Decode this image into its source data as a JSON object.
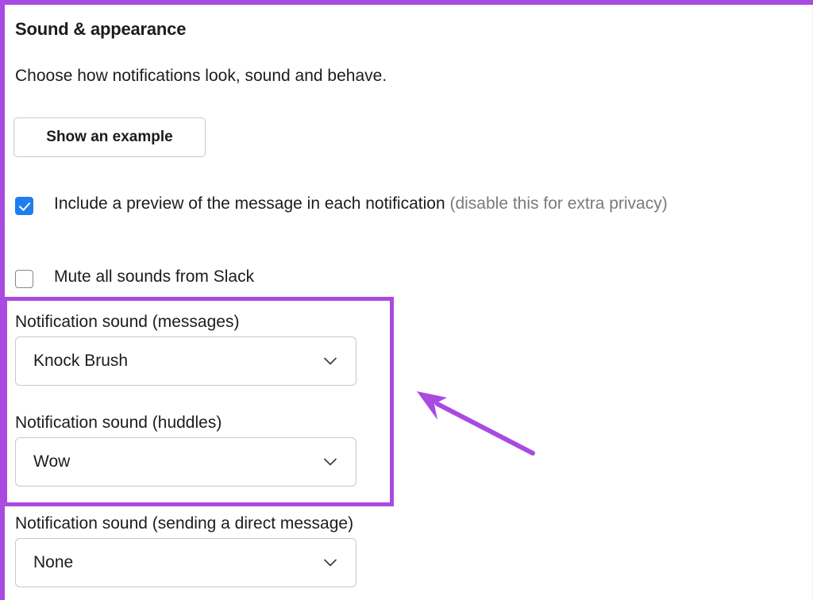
{
  "panel": {
    "title": "Sound & appearance",
    "subtitle": "Choose how notifications look, sound and behave.",
    "example_button_label": "Show an example"
  },
  "checkboxes": [
    {
      "name": "include-preview",
      "checked": true,
      "label_main": "Include a preview of the message in each notification ",
      "label_muted": "(disable this for extra privacy)"
    },
    {
      "name": "mute-all-sounds",
      "checked": false,
      "label_main": "Mute all sounds from Slack",
      "label_muted": ""
    }
  ],
  "fields": [
    {
      "name": "notification-sound-messages",
      "label": "Notification sound (messages)",
      "value": "Knock Brush",
      "icon": "chevron-down-icon"
    },
    {
      "name": "notification-sound-huddles",
      "label": "Notification sound (huddles)",
      "value": "Wow",
      "icon": "chevron-down-icon"
    },
    {
      "name": "notification-sound-direct-message",
      "label": "Notification sound (sending a direct message)",
      "value": "None",
      "icon": "chevron-down-icon"
    }
  ],
  "annotations": {
    "highlight_color": "#a94ae0",
    "arrow_color": "#a94ae0",
    "frame_color": "#a94ae0",
    "checkbox_checked_color": "#1e7ef0"
  }
}
